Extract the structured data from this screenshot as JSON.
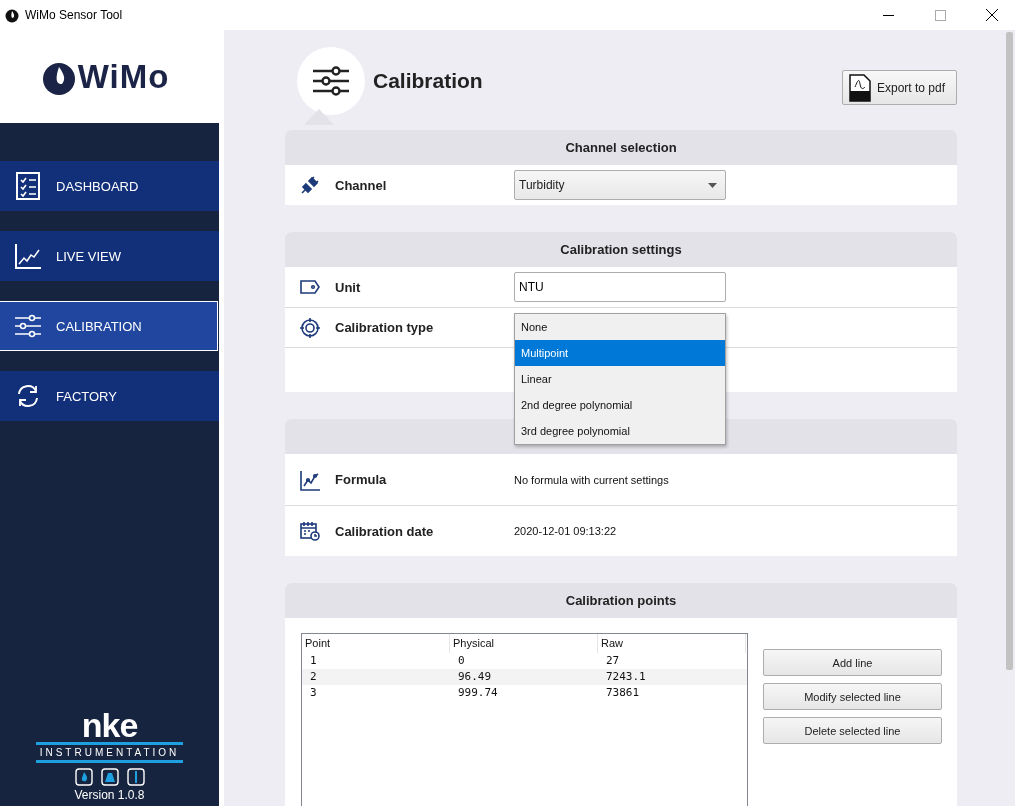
{
  "window": {
    "title": "WiMo Sensor Tool"
  },
  "sidebar": {
    "logo": "WiMo",
    "items": [
      {
        "label": "DASHBOARD",
        "selected": false
      },
      {
        "label": "LIVE VIEW",
        "selected": false
      },
      {
        "label": "CALIBRATION",
        "selected": true
      },
      {
        "label": "FACTORY",
        "selected": false
      }
    ],
    "brand": "nke",
    "brand_subtitle": "INSTRUMENTATION",
    "version": "Version 1.0.8"
  },
  "page": {
    "title": "Calibration",
    "export_button": "Export to pdf"
  },
  "sections": [
    {
      "title": "Channel selection",
      "rows": [
        {
          "kind": "select",
          "label": "Channel",
          "value": "Turbidity"
        }
      ]
    },
    {
      "title": "Calibration settings",
      "rows": [
        {
          "kind": "input",
          "label": "Unit",
          "value": "NTU"
        },
        {
          "kind": "dropdown",
          "label": "Calibration type",
          "options": [
            {
              "label": "None",
              "selected": false
            },
            {
              "label": "Multipoint",
              "selected": true
            },
            {
              "label": "Linear",
              "selected": false
            },
            {
              "label": "2nd degree polynomial",
              "selected": false
            },
            {
              "label": "3rd degree polynomial",
              "selected": false
            }
          ]
        },
        {
          "kind": "empty"
        }
      ]
    },
    {
      "rows": [
        {
          "kind": "text",
          "label": "Formula",
          "value": "No formula with current settings"
        },
        {
          "kind": "text",
          "label": "Calibration date",
          "value": "2020-12-01 09:13:22"
        }
      ]
    }
  ],
  "calibration_points": {
    "title": "Calibration points",
    "columns": [
      "Point",
      "Physical",
      "Raw"
    ],
    "rows": [
      {
        "cells": [
          "1",
          "0",
          "27"
        ]
      },
      {
        "cells": [
          "2",
          "96.49",
          "7243.1"
        ]
      },
      {
        "cells": [
          "3",
          "999.74",
          "73861"
        ]
      }
    ],
    "buttons": [
      "Add line",
      "Modify selected line",
      "Delete selected line"
    ]
  }
}
